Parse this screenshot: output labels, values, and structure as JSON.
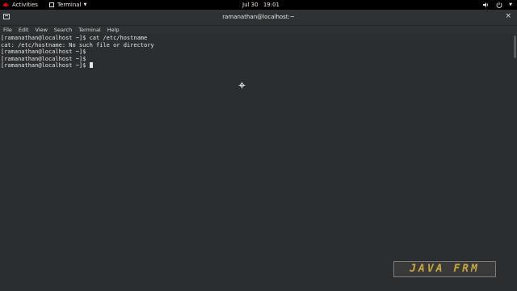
{
  "topbar": {
    "activities": "Activities",
    "app_name": "Terminal",
    "date": "Jul 30",
    "time": "19:01"
  },
  "window": {
    "title": "ramanathan@localhost:~",
    "close_glyph": "×"
  },
  "menu": {
    "file": "File",
    "edit": "Edit",
    "view": "View",
    "search": "Search",
    "terminal": "Terminal",
    "help": "Help"
  },
  "terminal": {
    "lines": [
      "[ramanathan@localhost ~]$ cat /etc/hostname",
      "cat: /etc/hostname: No such file or directory",
      "[ramanathan@localhost ~]$",
      "[ramanathan@localhost ~]$",
      "[ramanathan@localhost ~]$ "
    ]
  },
  "watermark": "JAVA FRM",
  "icons": {
    "redhat": "redhat-logo-icon",
    "volume": "volume-icon",
    "power": "power-icon",
    "menu": "chevron-down-icon"
  }
}
